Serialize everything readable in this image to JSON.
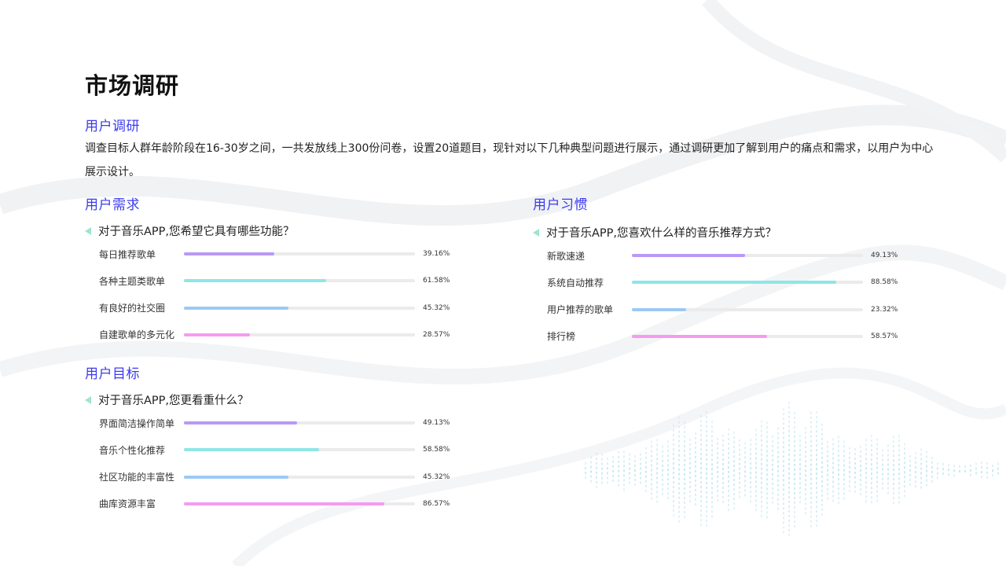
{
  "page": {
    "title": "市场调研",
    "section_user_research": "用户调研",
    "intro": "调查目标人群年龄阶段在16-30岁之间，一共发放线上300份问卷，设置20道题目，现针对以下几种典型问题进行展示，通过调研更加了解到用户的痛点和需求，以用户为中心展示设计。"
  },
  "chart_data": [
    {
      "type": "bar",
      "section": "用户需求",
      "question": "对于音乐APP,您希望它具有哪些功能？",
      "categories": [
        "每日推荐歌单",
        "各种主题类歌单",
        "有良好的社交圈",
        "自建歌单的多元化"
      ],
      "values": [
        39.16,
        61.58,
        45.32,
        28.57
      ],
      "labels": [
        "39.16%",
        "61.58%",
        "45.32%",
        "28.57%"
      ],
      "colors": [
        "#b79af5",
        "#8fe6e6",
        "#9cc9f5",
        "#f59bef"
      ],
      "xlim": [
        0,
        100
      ]
    },
    {
      "type": "bar",
      "section": "用户目标",
      "question": "对于音乐APP,您更看重什么？",
      "categories": [
        "界面简洁操作简单",
        "音乐个性化推荐",
        "社区功能的丰富性",
        "曲库资源丰富"
      ],
      "values": [
        49.13,
        58.58,
        45.32,
        86.57
      ],
      "labels": [
        "49.13%",
        "58.58%",
        "45.32%",
        "86.57%"
      ],
      "colors": [
        "#b79af5",
        "#8fe6e6",
        "#9cc9f5",
        "#f59bef"
      ],
      "xlim": [
        0,
        100
      ]
    },
    {
      "type": "bar",
      "section": "用户习惯",
      "question": "对于音乐APP,您喜欢什么样的音乐推荐方式？",
      "categories": [
        "新歌速递",
        "系统自动推荐",
        "用户推荐的歌单",
        "排行榜"
      ],
      "values": [
        49.13,
        88.58,
        23.32,
        58.57
      ],
      "labels": [
        "49.13%",
        "88.58%",
        "23.32%",
        "58.57%"
      ],
      "colors": [
        "#b79af5",
        "#8fe6e6",
        "#9cc9f5",
        "#f59bef"
      ],
      "xlim": [
        0,
        100
      ]
    }
  ]
}
